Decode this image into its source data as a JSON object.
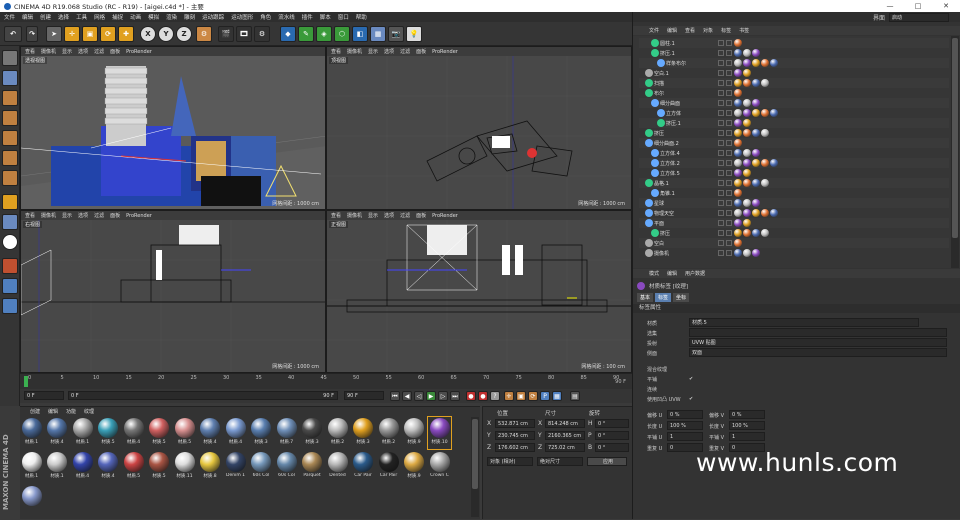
{
  "window": {
    "title": "CINEMA 4D R19.068 Studio (RC - R19) - [aigei.c4d *] - 主要",
    "minimize": "—",
    "maximize": "□",
    "close": "✕"
  },
  "menu": [
    "文件",
    "编辑",
    "创建",
    "选择",
    "工具",
    "网格",
    "捕捉",
    "动画",
    "模拟",
    "渲染",
    "雕刻",
    "运动跟踪",
    "运动图形",
    "角色",
    "流水线",
    "插件",
    "脚本",
    "窗口",
    "帮助"
  ],
  "layout": {
    "label": "界面",
    "value": "启动"
  },
  "viewport_menu": [
    "查看",
    "摄像机",
    "显示",
    "选项",
    "过滤",
    "面板",
    "ProRender"
  ],
  "viewports": [
    {
      "name": "透视视图",
      "grid": "网格间距 : 1000 cm"
    },
    {
      "name": "顶视图",
      "grid": "网格间距 : 1000 cm"
    },
    {
      "name": "右视图",
      "grid": "网格间距 : 1000 cm"
    },
    {
      "name": "正视图",
      "grid": "网格间距 : 100 cm"
    }
  ],
  "timeline": {
    "ticks": [
      "0",
      "5",
      "10",
      "15",
      "20",
      "25",
      "30",
      "35",
      "40",
      "45",
      "50",
      "55",
      "60",
      "65",
      "70",
      "75",
      "80",
      "85",
      "90"
    ],
    "end": "90 F"
  },
  "transport": {
    "current": "0 F",
    "start": "0 F",
    "max": "90 F",
    "end": "90 F"
  },
  "material_menu": [
    "创建",
    "编辑",
    "功能",
    "纹理"
  ],
  "materials_row1": [
    {
      "label": "材质.1",
      "color": "#4a6a9a"
    },
    {
      "label": "材质.4",
      "color": "#5577aa"
    },
    {
      "label": "材质.1",
      "color": "#aaaaaa"
    },
    {
      "label": "材质.5",
      "color": "#3aa0b8"
    },
    {
      "label": "材质.4",
      "color": "#777"
    },
    {
      "label": "材质.5",
      "color": "#d06060"
    },
    {
      "label": "材质.5",
      "color": "#d89090"
    },
    {
      "label": "材质.4",
      "color": "#6080b0"
    },
    {
      "label": "材质.4",
      "color": "#7a9ad0"
    },
    {
      "label": "材质.3",
      "color": "#5a7fb0"
    },
    {
      "label": "材质.7",
      "color": "#6f8fb8"
    },
    {
      "label": "材质.3",
      "color": "#4a4a4a"
    },
    {
      "label": "材质.2",
      "color": "#bbbbbb"
    },
    {
      "label": "材质.3",
      "color": "#e0a020"
    },
    {
      "label": "材质.2",
      "color": "#999"
    },
    {
      "label": "材质.9",
      "color": "#c0c0c0"
    },
    {
      "label": "材质.10",
      "color": "#8a4ac0"
    }
  ],
  "materials_row2": [
    {
      "label": "材质.1",
      "color": "#eeeeee"
    },
    {
      "label": "材质.1",
      "color": "#cccccc"
    },
    {
      "label": "材质.4",
      "color": "#3344aa"
    },
    {
      "label": "材质.4",
      "color": "#5566bb"
    },
    {
      "label": "材质.5",
      "color": "#cc4444"
    },
    {
      "label": "材质.5",
      "color": "#aa5544"
    },
    {
      "label": "材质.11",
      "color": "#dddddd"
    },
    {
      "label": "材质.8",
      "color": "#e8c840"
    },
    {
      "label": "Denim 1",
      "color": "#334466"
    },
    {
      "label": "60s Col",
      "color": "#7799bb"
    },
    {
      "label": "60s Col",
      "color": "#6688aa"
    },
    {
      "label": "Parquet",
      "color": "#aa8855"
    },
    {
      "label": "Dented",
      "color": "#b8b8b8"
    },
    {
      "label": "Car Pair",
      "color": "#2a5a8a"
    },
    {
      "label": "Car Pair",
      "color": "#222222"
    },
    {
      "label": "材质.9",
      "color": "#ddaa44"
    },
    {
      "label": "Crown C",
      "color": "#aaaaaa"
    }
  ],
  "materials_row3": [
    {
      "label": "",
      "color": "#8899cc"
    }
  ],
  "coords": {
    "headers": [
      "位置",
      "尺寸",
      "旋转"
    ],
    "rows": [
      {
        "axis": "X",
        "pos": "532.871 cm",
        "size_axis": "X",
        "size": "814.248 cm",
        "rot_axis": "H",
        "rot": "0 °"
      },
      {
        "axis": "Y",
        "pos": "230.745 cm",
        "size_axis": "Y",
        "size": "2160.365 cm",
        "rot_axis": "P",
        "rot": "0 °"
      },
      {
        "axis": "Z",
        "pos": "176.602 cm",
        "size_axis": "Z",
        "size": "725.02 cm",
        "rot_axis": "B",
        "rot": "0 °"
      }
    ],
    "mode": "对象 (相对)",
    "size_mode": "绝对尺寸",
    "apply": "应用"
  },
  "objects_menu": [
    "文件",
    "编辑",
    "查看",
    "对象",
    "标签",
    "书签"
  ],
  "objects": [
    {
      "name": "圆柱.1",
      "indent": 2,
      "color": "#3c8"
    },
    {
      "name": "挤压.1",
      "indent": 2,
      "color": "#3c8"
    },
    {
      "name": "样条布尔",
      "indent": 3,
      "color": "#6af"
    },
    {
      "name": "空白.1",
      "indent": 1,
      "color": "#aaa"
    },
    {
      "name": "扫描",
      "indent": 1,
      "color": "#3c8"
    },
    {
      "name": "布尔",
      "indent": 1,
      "color": "#3c8"
    },
    {
      "name": "细分曲面",
      "indent": 2,
      "color": "#6af"
    },
    {
      "name": "立方体",
      "indent": 3,
      "color": "#6af"
    },
    {
      "name": "挤压.1",
      "indent": 3,
      "color": "#3c8"
    },
    {
      "name": "挤压",
      "indent": 1,
      "color": "#3c8"
    },
    {
      "name": "细分曲面.2",
      "indent": 1,
      "color": "#6af"
    },
    {
      "name": "立方体.4",
      "indent": 2,
      "color": "#6af"
    },
    {
      "name": "立方体.2",
      "indent": 2,
      "color": "#6af"
    },
    {
      "name": "立方体.5",
      "indent": 2,
      "color": "#6af"
    },
    {
      "name": "晶格.1",
      "indent": 1,
      "color": "#3c8"
    },
    {
      "name": "角锥.1",
      "indent": 2,
      "color": "#6af"
    },
    {
      "name": "星球",
      "indent": 1,
      "color": "#6af"
    },
    {
      "name": "物理天空",
      "indent": 1,
      "color": "#6af"
    },
    {
      "name": "平面",
      "indent": 1,
      "color": "#6af"
    },
    {
      "name": "挤压",
      "indent": 2,
      "color": "#3c8"
    },
    {
      "name": "空白",
      "indent": 1,
      "color": "#aaa"
    },
    {
      "name": "摄像机",
      "indent": 1,
      "color": "#aaa"
    }
  ],
  "attr_menu": [
    "模式",
    "编辑",
    "用户数据"
  ],
  "attr_title": "材质标签 [纹理]",
  "attr_tabs": [
    "基本",
    "标签",
    "坐标"
  ],
  "attr_section": "标签属性",
  "attr_rows": [
    {
      "label": "材质",
      "value": "材质.5"
    },
    {
      "label": "选集",
      "value": ""
    },
    {
      "label": "投射",
      "value": "UVW 贴图"
    },
    {
      "label": "侧面",
      "value": "双面"
    }
  ],
  "attr_checks": [
    {
      "label": "混合纹理",
      "value": ""
    },
    {
      "label": "平铺",
      "value": "✔"
    },
    {
      "label": "连续",
      "value": ""
    },
    {
      "label": "使用凹凸 UVW",
      "value": "✔"
    }
  ],
  "attr_pairs": [
    {
      "l1": "偏移 U",
      "v1": "0 %",
      "l2": "偏移 V",
      "v2": "0 %"
    },
    {
      "l1": "长度 U",
      "v1": "100 %",
      "l2": "长度 V",
      "v2": "100 %"
    },
    {
      "l1": "平铺 U",
      "v1": "1",
      "l2": "平铺 V",
      "v2": "1"
    },
    {
      "l1": "重复 U",
      "v1": "0",
      "l2": "重复 V",
      "v2": "0"
    }
  ],
  "watermark": "www.hunls.com",
  "brand": "MAXON CINEMA 4D",
  "toolbar_axes": [
    "X",
    "Y",
    "Z"
  ]
}
